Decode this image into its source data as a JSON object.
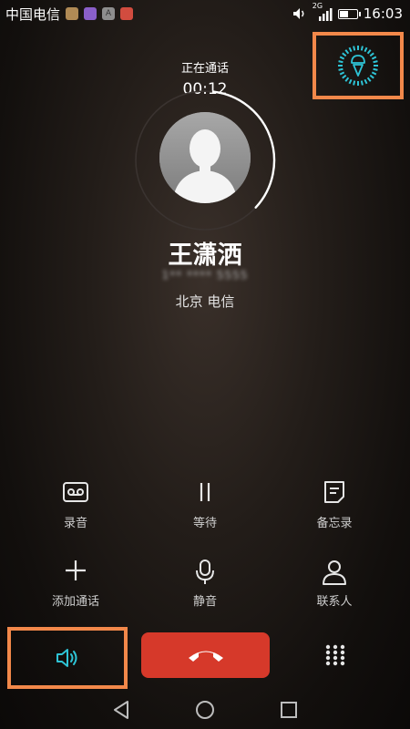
{
  "status_bar": {
    "carrier": "中国电信",
    "network_tag": "2G",
    "time": "16:03",
    "app_icons": [
      "pie-app-icon",
      "purple-app-icon",
      "a-app-icon",
      "red-app-icon"
    ]
  },
  "call": {
    "state": "正在通话",
    "duration": "00:12",
    "contact_name": "王潇洒",
    "phone_number": "1** **** 5555",
    "location": "北京 电信"
  },
  "actions": [
    {
      "label": "录音",
      "icon": "voicemail-icon"
    },
    {
      "label": "等待",
      "icon": "pause-icon"
    },
    {
      "label": "备忘录",
      "icon": "memo-icon"
    },
    {
      "label": "添加通话",
      "icon": "add-icon"
    },
    {
      "label": "静音",
      "icon": "mic-icon"
    },
    {
      "label": "联系人",
      "icon": "contact-icon"
    }
  ],
  "colors": {
    "accent": "#2ec4d6",
    "highlight": "#f2884a",
    "end_call": "#d6392a"
  },
  "call_progress_fraction": 0.35
}
